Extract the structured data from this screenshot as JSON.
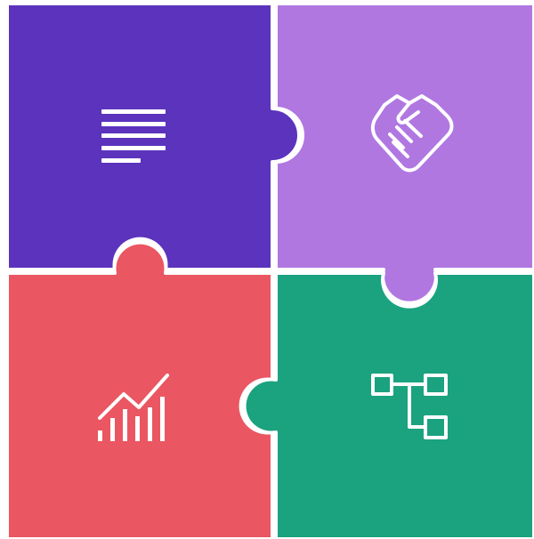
{
  "puzzle": {
    "pieces": [
      {
        "id": "document",
        "color": "#5b33bd",
        "icon": "document-lines-icon"
      },
      {
        "id": "partnership",
        "color": "#b077e1",
        "icon": "handshake-icon"
      },
      {
        "id": "growth",
        "color": "#ea5661",
        "icon": "growth-chart-icon"
      },
      {
        "id": "structure",
        "color": "#1ba27f",
        "icon": "org-chart-icon"
      }
    ]
  }
}
